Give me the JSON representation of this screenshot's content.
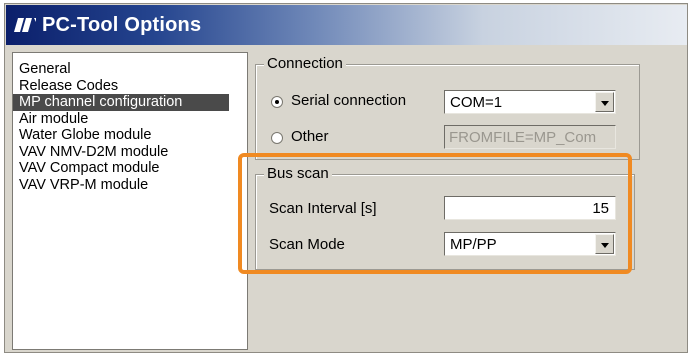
{
  "window": {
    "title": "PC-Tool Options"
  },
  "tree": {
    "items": [
      {
        "label": "General",
        "selected": false
      },
      {
        "label": "Release Codes",
        "selected": false
      },
      {
        "label": "MP channel configuration",
        "selected": true
      },
      {
        "label": "Air module",
        "selected": false
      },
      {
        "label": "Water Globe module",
        "selected": false
      },
      {
        "label": "VAV NMV-D2M module",
        "selected": false
      },
      {
        "label": "VAV Compact module",
        "selected": false
      },
      {
        "label": "VAV VRP-M module",
        "selected": false
      }
    ]
  },
  "connection": {
    "legend": "Connection",
    "serial_label": "Serial connection",
    "serial_value": "COM=1",
    "other_label": "Other",
    "other_value": "FROMFILE=MP_Com"
  },
  "bus_scan": {
    "legend": "Bus scan",
    "interval_label": "Scan Interval [s]",
    "interval_value": "15",
    "mode_label": "Scan Mode",
    "mode_value": "MP/PP"
  },
  "colors": {
    "highlight": "#f08a22",
    "title_bar": "#0b1f6b",
    "selection": "#4a4a4a"
  }
}
